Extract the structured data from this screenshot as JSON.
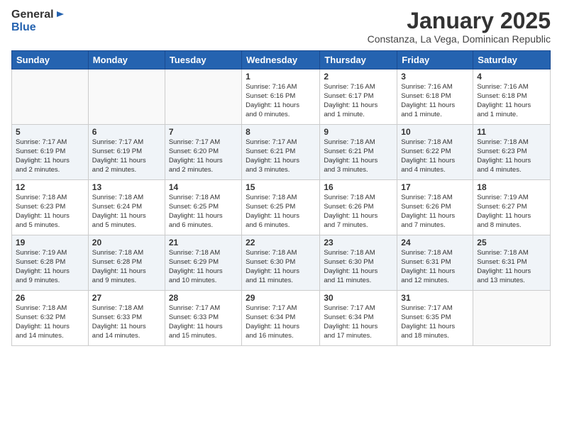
{
  "header": {
    "logo_line1": "General",
    "logo_line2": "Blue",
    "month_year": "January 2025",
    "location": "Constanza, La Vega, Dominican Republic"
  },
  "days_of_week": [
    "Sunday",
    "Monday",
    "Tuesday",
    "Wednesday",
    "Thursday",
    "Friday",
    "Saturday"
  ],
  "weeks": [
    [
      {
        "num": "",
        "info": ""
      },
      {
        "num": "",
        "info": ""
      },
      {
        "num": "",
        "info": ""
      },
      {
        "num": "1",
        "info": "Sunrise: 7:16 AM\nSunset: 6:16 PM\nDaylight: 11 hours\nand 0 minutes."
      },
      {
        "num": "2",
        "info": "Sunrise: 7:16 AM\nSunset: 6:17 PM\nDaylight: 11 hours\nand 1 minute."
      },
      {
        "num": "3",
        "info": "Sunrise: 7:16 AM\nSunset: 6:18 PM\nDaylight: 11 hours\nand 1 minute."
      },
      {
        "num": "4",
        "info": "Sunrise: 7:16 AM\nSunset: 6:18 PM\nDaylight: 11 hours\nand 1 minute."
      }
    ],
    [
      {
        "num": "5",
        "info": "Sunrise: 7:17 AM\nSunset: 6:19 PM\nDaylight: 11 hours\nand 2 minutes."
      },
      {
        "num": "6",
        "info": "Sunrise: 7:17 AM\nSunset: 6:19 PM\nDaylight: 11 hours\nand 2 minutes."
      },
      {
        "num": "7",
        "info": "Sunrise: 7:17 AM\nSunset: 6:20 PM\nDaylight: 11 hours\nand 2 minutes."
      },
      {
        "num": "8",
        "info": "Sunrise: 7:17 AM\nSunset: 6:21 PM\nDaylight: 11 hours\nand 3 minutes."
      },
      {
        "num": "9",
        "info": "Sunrise: 7:18 AM\nSunset: 6:21 PM\nDaylight: 11 hours\nand 3 minutes."
      },
      {
        "num": "10",
        "info": "Sunrise: 7:18 AM\nSunset: 6:22 PM\nDaylight: 11 hours\nand 4 minutes."
      },
      {
        "num": "11",
        "info": "Sunrise: 7:18 AM\nSunset: 6:23 PM\nDaylight: 11 hours\nand 4 minutes."
      }
    ],
    [
      {
        "num": "12",
        "info": "Sunrise: 7:18 AM\nSunset: 6:23 PM\nDaylight: 11 hours\nand 5 minutes."
      },
      {
        "num": "13",
        "info": "Sunrise: 7:18 AM\nSunset: 6:24 PM\nDaylight: 11 hours\nand 5 minutes."
      },
      {
        "num": "14",
        "info": "Sunrise: 7:18 AM\nSunset: 6:25 PM\nDaylight: 11 hours\nand 6 minutes."
      },
      {
        "num": "15",
        "info": "Sunrise: 7:18 AM\nSunset: 6:25 PM\nDaylight: 11 hours\nand 6 minutes."
      },
      {
        "num": "16",
        "info": "Sunrise: 7:18 AM\nSunset: 6:26 PM\nDaylight: 11 hours\nand 7 minutes."
      },
      {
        "num": "17",
        "info": "Sunrise: 7:18 AM\nSunset: 6:26 PM\nDaylight: 11 hours\nand 7 minutes."
      },
      {
        "num": "18",
        "info": "Sunrise: 7:19 AM\nSunset: 6:27 PM\nDaylight: 11 hours\nand 8 minutes."
      }
    ],
    [
      {
        "num": "19",
        "info": "Sunrise: 7:19 AM\nSunset: 6:28 PM\nDaylight: 11 hours\nand 9 minutes."
      },
      {
        "num": "20",
        "info": "Sunrise: 7:18 AM\nSunset: 6:28 PM\nDaylight: 11 hours\nand 9 minutes."
      },
      {
        "num": "21",
        "info": "Sunrise: 7:18 AM\nSunset: 6:29 PM\nDaylight: 11 hours\nand 10 minutes."
      },
      {
        "num": "22",
        "info": "Sunrise: 7:18 AM\nSunset: 6:30 PM\nDaylight: 11 hours\nand 11 minutes."
      },
      {
        "num": "23",
        "info": "Sunrise: 7:18 AM\nSunset: 6:30 PM\nDaylight: 11 hours\nand 11 minutes."
      },
      {
        "num": "24",
        "info": "Sunrise: 7:18 AM\nSunset: 6:31 PM\nDaylight: 11 hours\nand 12 minutes."
      },
      {
        "num": "25",
        "info": "Sunrise: 7:18 AM\nSunset: 6:31 PM\nDaylight: 11 hours\nand 13 minutes."
      }
    ],
    [
      {
        "num": "26",
        "info": "Sunrise: 7:18 AM\nSunset: 6:32 PM\nDaylight: 11 hours\nand 14 minutes."
      },
      {
        "num": "27",
        "info": "Sunrise: 7:18 AM\nSunset: 6:33 PM\nDaylight: 11 hours\nand 14 minutes."
      },
      {
        "num": "28",
        "info": "Sunrise: 7:17 AM\nSunset: 6:33 PM\nDaylight: 11 hours\nand 15 minutes."
      },
      {
        "num": "29",
        "info": "Sunrise: 7:17 AM\nSunset: 6:34 PM\nDaylight: 11 hours\nand 16 minutes."
      },
      {
        "num": "30",
        "info": "Sunrise: 7:17 AM\nSunset: 6:34 PM\nDaylight: 11 hours\nand 17 minutes."
      },
      {
        "num": "31",
        "info": "Sunrise: 7:17 AM\nSunset: 6:35 PM\nDaylight: 11 hours\nand 18 minutes."
      },
      {
        "num": "",
        "info": ""
      }
    ]
  ]
}
